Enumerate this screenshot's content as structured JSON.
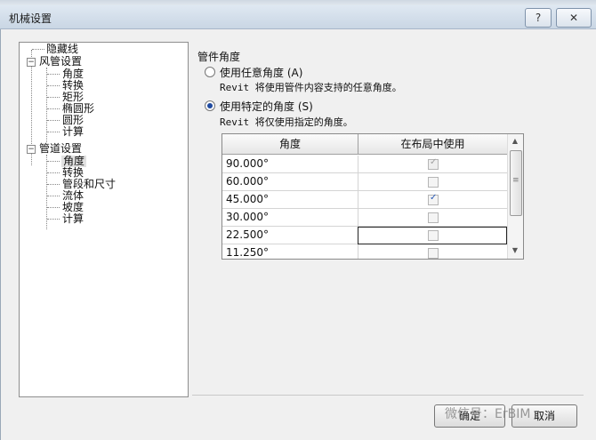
{
  "window": {
    "title": "机械设置",
    "help_glyph": "?",
    "close_glyph": "✕"
  },
  "tree": {
    "items": [
      {
        "label": "隐藏线",
        "selected": false
      },
      {
        "label": "风管设置",
        "expander": "−"
      },
      {
        "label": "角度"
      },
      {
        "label": "转换"
      },
      {
        "label": "矩形"
      },
      {
        "label": "椭圆形"
      },
      {
        "label": "圆形"
      },
      {
        "label": "计算"
      },
      {
        "label": "管道设置",
        "expander": "−"
      },
      {
        "label": "角度",
        "selected": true
      },
      {
        "label": "转换"
      },
      {
        "label": "管段和尺寸"
      },
      {
        "label": "流体"
      },
      {
        "label": "坡度"
      },
      {
        "label": "计算"
      }
    ]
  },
  "panel": {
    "title": "管件角度",
    "option_any": {
      "label": "使用任意角度 (A)",
      "note": "Revit 将使用管件内容支持的任意角度。",
      "checked": false
    },
    "option_specific": {
      "label": "使用特定的角度 (S)",
      "note": "Revit 将仅使用指定的角度。",
      "checked": true
    }
  },
  "table": {
    "headers": [
      "角度",
      "在布局中使用"
    ],
    "rows": [
      {
        "angle": "90.000°",
        "checked": true,
        "disabled": true
      },
      {
        "angle": "60.000°",
        "checked": false,
        "disabled": false
      },
      {
        "angle": "45.000°",
        "checked": true,
        "disabled": false
      },
      {
        "angle": "30.000°",
        "checked": false,
        "disabled": false
      },
      {
        "angle": "22.500°",
        "checked": false,
        "disabled": false,
        "focused": true
      },
      {
        "angle": "11.250°",
        "checked": false,
        "disabled": false
      }
    ],
    "scroll_up": "▲",
    "scroll_down": "▼",
    "grip": "≡"
  },
  "buttons": {
    "ok": "确定",
    "cancel": "取消"
  },
  "watermark": "微信号：ErBIM"
}
